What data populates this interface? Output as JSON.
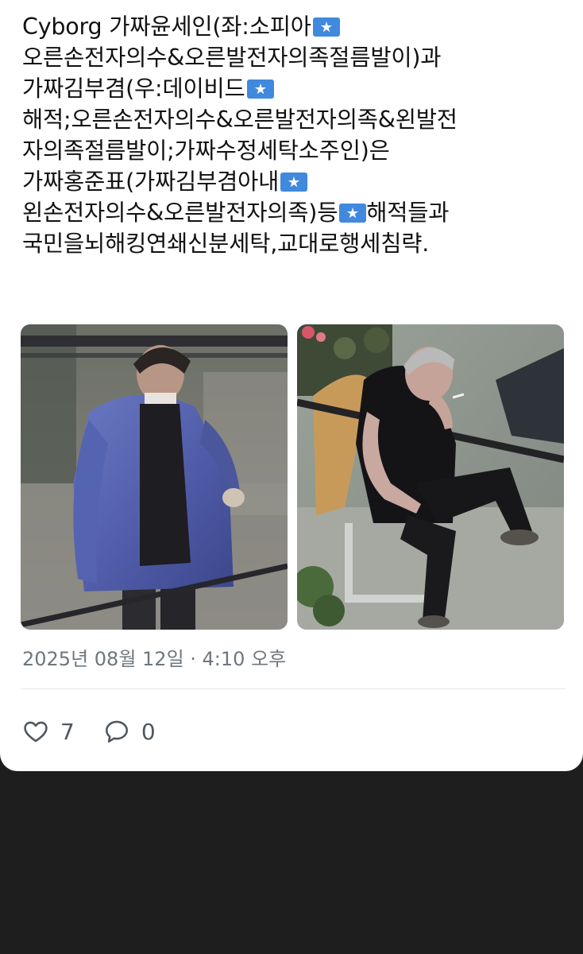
{
  "post": {
    "lines": [
      "Cyborg 가짜윤세인(좌:소피아",
      "오른손전자의수&오른발전자의족절름발이)과",
      "가짜김부겸(우:데이비드",
      "해적;오른손전자의수&오른발전자의족&왼발전",
      "자의족절름발이;가짜수정세탁소주인)은",
      "가짜홍준표(가짜김부겸아내",
      "왼손전자의수&오른발전자의족)등",
      "해적들과",
      "국민을뇌해킹연쇄신분세탁,교대로행세침략."
    ],
    "flag_icon": "somalia-flag-emoji",
    "timestamp": "2025년 08월 12일 · 4:10 오후",
    "likes": "7",
    "replies": "0",
    "colors": {
      "card": "#ffffff",
      "background": "#1e1e1e",
      "text": "#111111",
      "muted": "#6e767d",
      "flag_blue": "#4189dd"
    }
  },
  "icons": {
    "like": "heart-outline-icon",
    "reply": "speech-bubble-outline-icon"
  }
}
